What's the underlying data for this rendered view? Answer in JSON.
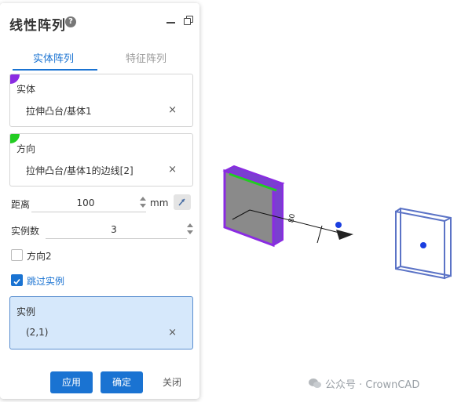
{
  "panel": {
    "title": "线性阵列",
    "help_icon": "?",
    "tabs": [
      {
        "label": "实体阵列",
        "active": true
      },
      {
        "label": "特征阵列",
        "active": false
      }
    ],
    "solid_box": {
      "label": "实体",
      "value": "拉伸凸台/基体1",
      "remove": "×",
      "marker_color": "#8a2be2"
    },
    "direction_box": {
      "label": "方向",
      "value": "拉伸凸台/基体1的边线[2]",
      "remove": "×",
      "marker_color": "#22cc22"
    },
    "distance": {
      "label": "距离",
      "value": "100",
      "unit": "mm"
    },
    "count": {
      "label": "实例数",
      "value": "3"
    },
    "direction2": {
      "label": "方向2",
      "checked": false
    },
    "skip": {
      "label": "跳过实例",
      "checked": true
    },
    "instance_box": {
      "label": "实例",
      "value": "(2,1)",
      "remove": "×"
    },
    "buttons": {
      "apply": "应用",
      "ok": "确定",
      "close": "关闭"
    }
  },
  "viewport": {
    "dimension_label": "80"
  },
  "watermark": "公众号 · CrownCAD",
  "colors": {
    "accent": "#1a73d2",
    "selected_body": "#8a2be2",
    "direction_edge": "#22cc22",
    "preview_outline": "#5b73c6"
  }
}
